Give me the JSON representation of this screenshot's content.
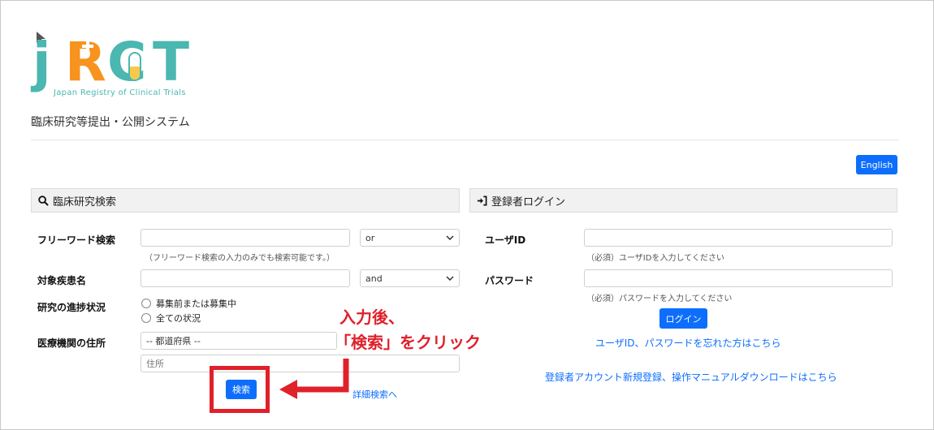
{
  "brand": {
    "logo_letters": [
      "j",
      "R",
      "C",
      "T"
    ],
    "logo_subtitle": "Japan Registry of Clinical Trials",
    "site_subtitle": "臨床研究等提出・公開システム",
    "colors": {
      "teal": "#4ab7b0",
      "orange": "#f7931e",
      "accent": "#0d6efd",
      "annotation": "#e0202a"
    }
  },
  "lang_button": "English",
  "search": {
    "header": "臨床研究検索",
    "free_word_label": "フリーワード検索",
    "free_word_value": "",
    "free_word_op": "or",
    "free_word_help": "（フリーワード検索の入力のみでも検索可能です。）",
    "disease_label": "対象疾患名",
    "disease_value": "",
    "disease_op": "and",
    "progress_label": "研究の進捗状況",
    "progress_options": [
      "募集前または募集中",
      "全ての状況"
    ],
    "address_label": "医療機関の住所",
    "prefecture_select": "-- 都道府県 --",
    "address_placeholder": "住所",
    "search_button": "検索",
    "advanced_link": "詳細検索へ"
  },
  "login": {
    "header": "登録者ログイン",
    "userid_label": "ユーザID",
    "userid_value": "",
    "userid_help": "（必須）ユーザIDを入力してください",
    "password_label": "パスワード",
    "password_value": "",
    "password_help": "（必須）パスワードを入力してください",
    "login_button": "ログイン",
    "forgot_link": "ユーザID、パスワードを忘れた方はこちら",
    "register_link": "登録者アカウント新規登録、操作マニュアルダウンロードはこちら"
  },
  "annotation": {
    "line1": "入力後、",
    "line2": "「検索」をクリック"
  },
  "icons": [
    "cursor-arrow-icon",
    "search-icon",
    "login-icon",
    "chevron-down-icon"
  ]
}
